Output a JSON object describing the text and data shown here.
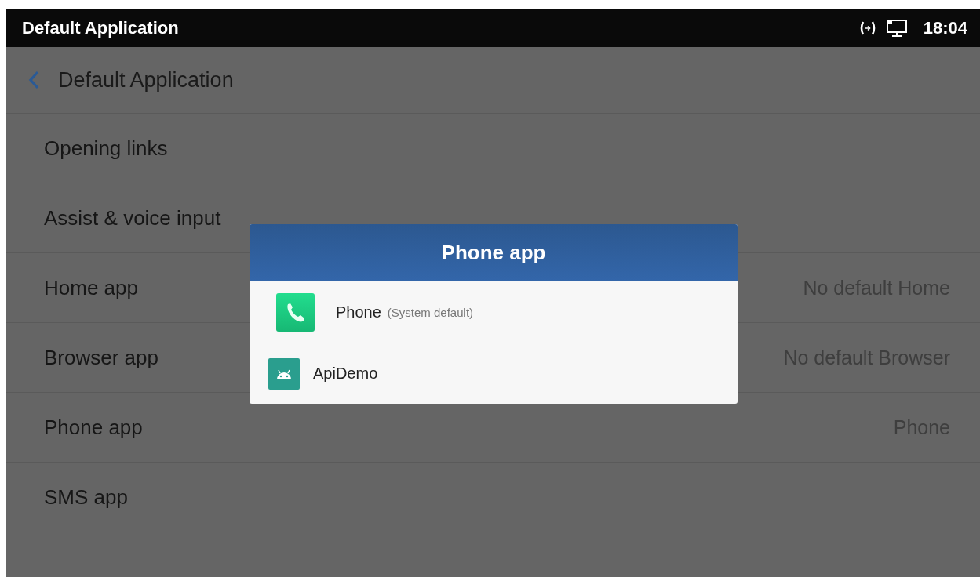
{
  "status_bar": {
    "title": "Default Application",
    "time": "18:04"
  },
  "header": {
    "title": "Default Application"
  },
  "settings": [
    {
      "label": "Opening links"
    },
    {
      "label": "Assist & voice input"
    },
    {
      "label": "Home app",
      "value": "No default Home"
    },
    {
      "label": "Browser app",
      "value": "No default Browser"
    },
    {
      "label": "Phone app",
      "value": "Phone"
    },
    {
      "label": "SMS app"
    }
  ],
  "dialog": {
    "title": "Phone app",
    "options": [
      {
        "kind": "phone",
        "label": "Phone",
        "note": "(System default)"
      },
      {
        "kind": "android",
        "label": "ApiDemo"
      }
    ]
  }
}
